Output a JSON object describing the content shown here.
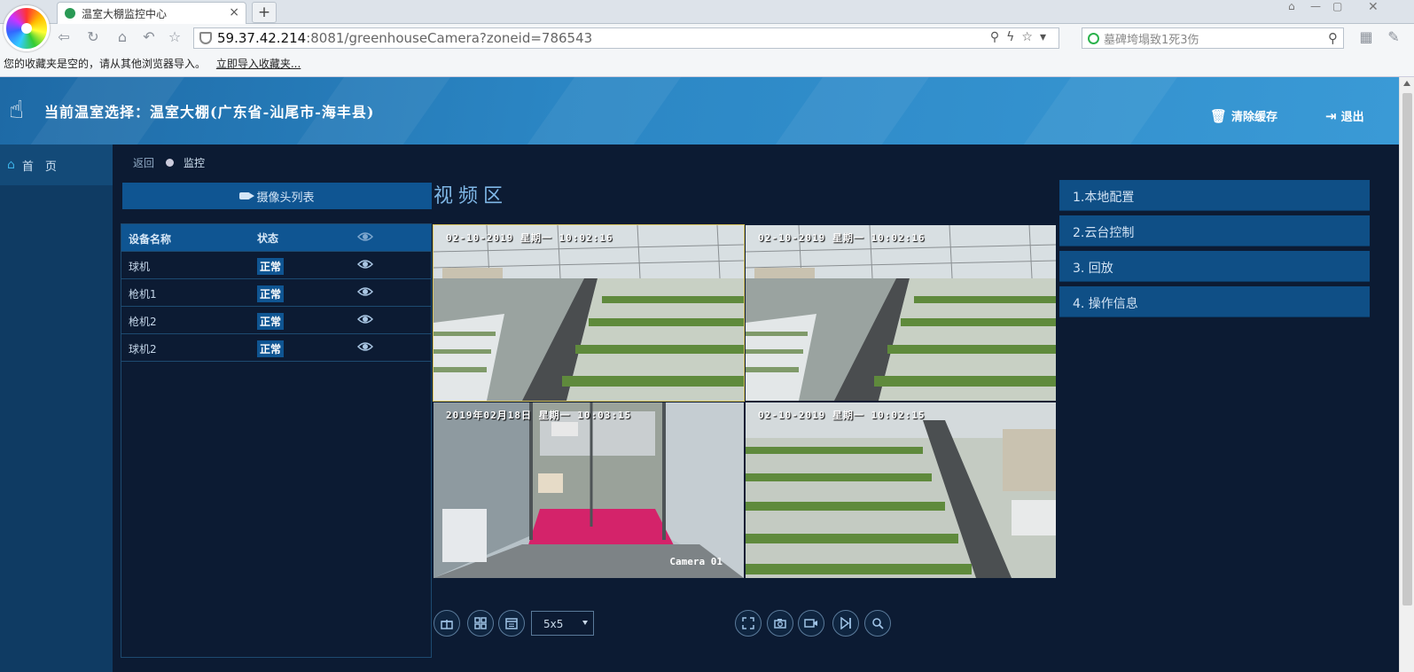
{
  "browser": {
    "tab_title": "温室大棚监控中心",
    "tab_close": "×",
    "newtab": "+",
    "url_host": "59.37.42.214",
    "url_path": ":8081/greenhouseCamera?zoneid=786543",
    "search_text": "墓碑垮塌致1死3伤",
    "bookmarks_empty": "您的收藏夹是空的，请从其他浏览器导入。",
    "bookmarks_import": "立即导入收藏夹..."
  },
  "header": {
    "title": "当前温室选择：温室大棚(广东省-汕尾市-海丰县)",
    "clear_cache": "清除缓存",
    "logout": "退出"
  },
  "sidebar": {
    "items": [
      {
        "label": "首　页"
      }
    ]
  },
  "breadcrumb": {
    "back": "返回",
    "current": "监控"
  },
  "camera_list": {
    "title": "摄像头列表",
    "columns": [
      "设备名称",
      "状态"
    ],
    "rows": [
      {
        "name": "球机",
        "status": "正常"
      },
      {
        "name": "枪机1",
        "status": "正常"
      },
      {
        "name": "枪机2",
        "status": "正常"
      },
      {
        "name": "球机2",
        "status": "正常"
      }
    ]
  },
  "video": {
    "title": "视频区",
    "cells": [
      {
        "osd": "02-10-2019 星期一 10:02:16",
        "label": ""
      },
      {
        "osd": "02-10-2019 星期一 10:02:16",
        "label": ""
      },
      {
        "osd": "2019年02月18日 星期一 10:03:15",
        "label": "Camera 01"
      },
      {
        "osd": "02-10-2019 星期一 10:02:15",
        "label": ""
      }
    ],
    "layout_select": "5x5"
  },
  "panels": [
    {
      "label": "1.本地配置"
    },
    {
      "label": "2.云台控制"
    },
    {
      "label": "3. 回放"
    },
    {
      "label": "4. 操作信息"
    }
  ],
  "colors": {
    "header": "#2b86c4",
    "sidebar": "#0f3b63",
    "main": "#0c1b33",
    "accent": "#0f5592"
  }
}
